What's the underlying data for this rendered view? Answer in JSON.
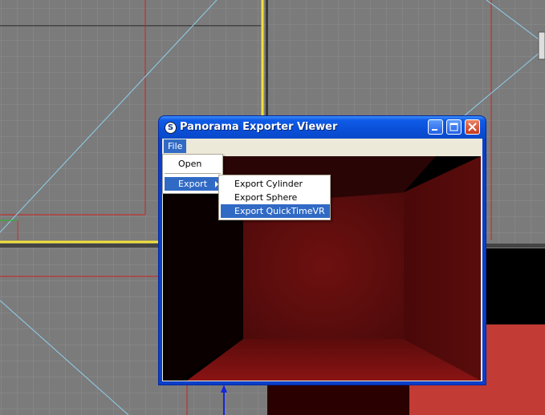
{
  "window": {
    "title": "Panorama Exporter Viewer"
  },
  "menubar": {
    "file_label": "File"
  },
  "file_menu": {
    "open_label": "Open",
    "export_label": "Export"
  },
  "export_submenu": {
    "items": [
      {
        "label": "Export Cylinder",
        "highlighted": false
      },
      {
        "label": "Export Sphere",
        "highlighted": false
      },
      {
        "label": "Export QuickTimeVR",
        "highlighted": true
      }
    ]
  },
  "colors": {
    "title_bar": "#0a4fd8",
    "menu_highlight": "#316ac5",
    "viewport_grid": "#7b7b7b",
    "room_red": "#8b1a1a"
  }
}
